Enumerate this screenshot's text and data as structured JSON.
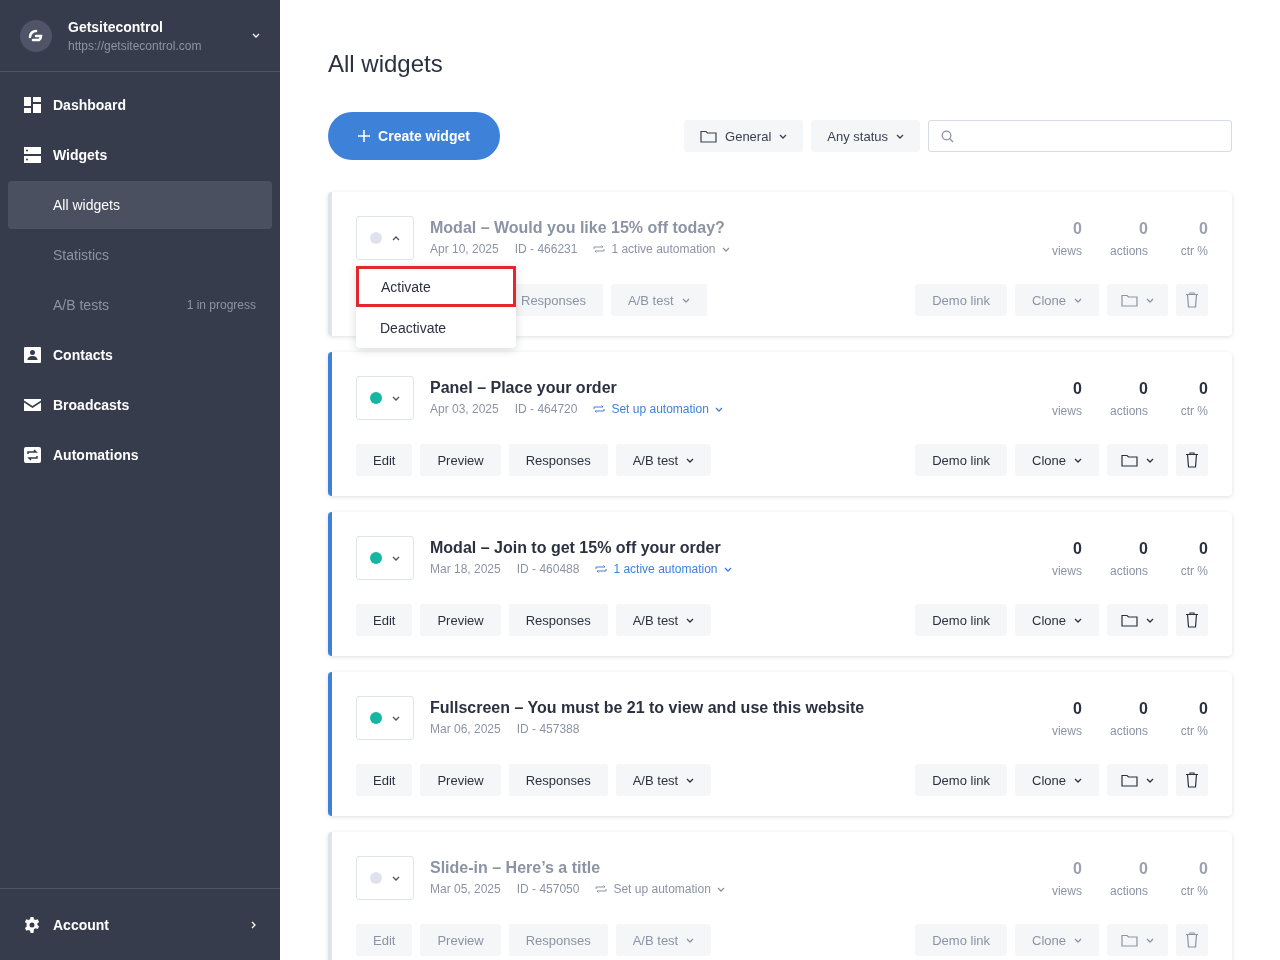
{
  "account": {
    "name": "Getsitecontrol",
    "url": "https://getsitecontrol.com"
  },
  "nav": [
    {
      "label": "Dashboard",
      "selected": false
    },
    {
      "label": "Widgets",
      "selected": false,
      "children": [
        {
          "label": "All widgets",
          "selected": true
        },
        {
          "label": "Statistics",
          "selected": false
        },
        {
          "label": "A/B tests",
          "selected": false,
          "badge": "1 in progress"
        }
      ]
    },
    {
      "label": "Contacts",
      "selected": false
    },
    {
      "label": "Broadcasts",
      "selected": false
    },
    {
      "label": "Automations",
      "selected": false
    }
  ],
  "footer": {
    "label": "Account"
  },
  "page_title": "All widgets",
  "create_button": "Create widget",
  "filters": [
    {
      "label": "General"
    },
    {
      "label": "Any status"
    }
  ],
  "widgets": [
    {
      "title": "Modal – Would you like 15% off today?",
      "date": "Apr 10, 2025",
      "id": "ID - 466231",
      "automation": "1 active automation",
      "active": false,
      "expanded": true,
      "menu": [
        {
          "label": "Activate",
          "selected": true
        },
        {
          "label": "Deactivate",
          "selected": false
        }
      ],
      "stats": [
        {
          "value": "0",
          "label": "views"
        },
        {
          "value": "0",
          "label": "actions"
        },
        {
          "value": "0",
          "label": "ctr %"
        }
      ],
      "buttons": [
        "Responses",
        "A/B test"
      ],
      "right_buttons": [
        "Demo link",
        "Clone"
      ]
    },
    {
      "title": "Panel – Place your order",
      "date": "Apr 03, 2025",
      "id": "ID - 464720",
      "automation": "Set up automation",
      "active": true,
      "expanded": false,
      "stats": [
        {
          "value": "0",
          "label": "views"
        },
        {
          "value": "0",
          "label": "actions"
        },
        {
          "value": "0",
          "label": "ctr %"
        }
      ],
      "buttons": [
        "Edit",
        "Preview",
        "Responses",
        "A/B test"
      ],
      "right_buttons": [
        "Demo link",
        "Clone"
      ]
    },
    {
      "title": "Modal – Join to get 15% off your order",
      "date": "Mar 18, 2025",
      "id": "ID - 460488",
      "automation": "1 active automation",
      "active": true,
      "expanded": false,
      "stats": [
        {
          "value": "0",
          "label": "views"
        },
        {
          "value": "0",
          "label": "actions"
        },
        {
          "value": "0",
          "label": "ctr %"
        }
      ],
      "buttons": [
        "Edit",
        "Preview",
        "Responses",
        "A/B test"
      ],
      "right_buttons": [
        "Demo link",
        "Clone"
      ]
    },
    {
      "title": "Fullscreen – You must be 21 to view and use this website",
      "date": "Mar 06, 2025",
      "id": "ID - 457388",
      "active": true,
      "expanded": false,
      "stats": [
        {
          "value": "0",
          "label": "views"
        },
        {
          "value": "0",
          "label": "actions"
        },
        {
          "value": "0",
          "label": "ctr %"
        }
      ],
      "buttons": [
        "Edit",
        "Preview",
        "Responses",
        "A/B test"
      ],
      "right_buttons": [
        "Demo link",
        "Clone"
      ]
    },
    {
      "title": "Slide-in – Here’s a title",
      "date": "Mar 05, 2025",
      "id": "ID - 457050",
      "automation": "Set up automation",
      "active": false,
      "expanded": false,
      "stats": [
        {
          "value": "0",
          "label": "views"
        },
        {
          "value": "0",
          "label": "actions"
        },
        {
          "value": "0",
          "label": "ctr %"
        }
      ],
      "buttons": [
        "Edit",
        "Preview",
        "Responses",
        "A/B test"
      ],
      "right_buttons": [
        "Demo link",
        "Clone"
      ]
    }
  ]
}
